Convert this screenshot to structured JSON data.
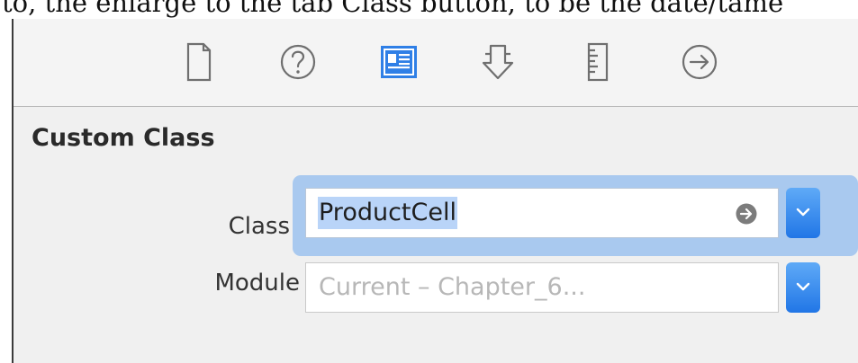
{
  "background_caption": {
    "text": "to, the enlarge to the tab Class button, to be the date/tame"
  },
  "inspector": {
    "tabs": [
      {
        "icon": "file-icon",
        "label": "File Inspector"
      },
      {
        "icon": "help-circle-icon",
        "label": "Quick Help Inspector"
      },
      {
        "icon": "identity-icon",
        "label": "Identity Inspector"
      },
      {
        "icon": "attributes-icon",
        "label": "Attributes Inspector"
      },
      {
        "icon": "ruler-icon",
        "label": "Size Inspector"
      },
      {
        "icon": "arrow-circle-icon",
        "label": "Connections Inspector"
      }
    ],
    "active_tab": 2,
    "accent_color": "#2f7fe6",
    "section_title": "Custom Class",
    "class_field": {
      "label": "Class",
      "value": "ProductCell"
    },
    "module_field": {
      "label": "Module",
      "placeholder": "Current – Chapter_6..."
    }
  }
}
